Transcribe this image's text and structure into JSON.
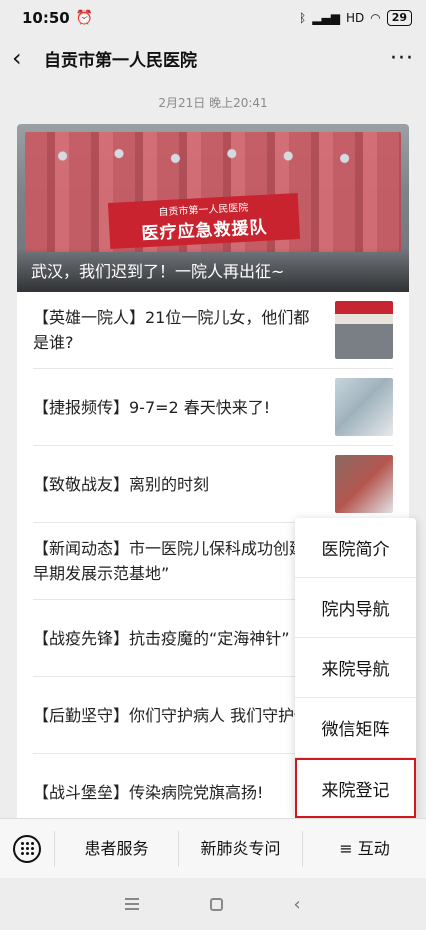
{
  "status_bar": {
    "time": "10:50",
    "alarm_icon": "alarm-icon",
    "signal_text": "HD",
    "battery": "29"
  },
  "nav": {
    "back_icon": "chevron-left-icon",
    "title": "自贡市第一人民医院",
    "more": "···"
  },
  "timestamp": "2月21日 晚上20:41",
  "hero": {
    "banner_line1": "自贡市第一人民医院",
    "banner_line2": "医疗应急救援队",
    "caption": "武汉，我们迟到了！一院人再出征~"
  },
  "articles": [
    {
      "title": "【英雄一院人】21位一院儿女，他们都是谁?",
      "thumb": "photo"
    },
    {
      "title": "【捷报频传】9-7=2 春天快来了!",
      "thumb": "photo"
    },
    {
      "title": "【致敬战友】离别的时刻",
      "thumb": "photo"
    },
    {
      "title": "【新闻动态】市一医院儿保科成功创建省级儿童早期发展示范基地”",
      "thumb": ""
    },
    {
      "title": "【战疫先锋】抗击疫魔的“定海神针”",
      "thumb": ""
    },
    {
      "title": "【后勤坚守】你们守护病人  我们守护你",
      "thumb": ""
    },
    {
      "title": "【战斗堡垒】传染病院党旗高扬!",
      "thumb": ""
    }
  ],
  "popup_menu": {
    "items": [
      "医院简介",
      "院内导航",
      "来院导航",
      "微信矩阵",
      "来院登记"
    ],
    "highlighted_index": 4,
    "highlight_color": "#d0191f"
  },
  "bottom_menu": {
    "keyboard_icon": "keyboard-icon",
    "tabs": [
      "患者服务",
      "新肺炎专问",
      "≡ 互动"
    ]
  },
  "system_nav": {
    "menu_icon": "menu-icon",
    "home_icon": "home-icon",
    "back_icon": "back-icon",
    "back_glyph": "‹"
  }
}
